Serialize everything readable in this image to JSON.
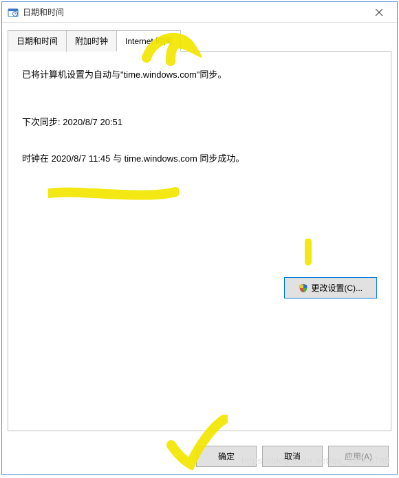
{
  "window": {
    "title": "日期和时间"
  },
  "tabs": [
    {
      "label": "日期和时间",
      "active": false
    },
    {
      "label": "附加时钟",
      "active": false
    },
    {
      "label": "Internet 时间",
      "active": true
    }
  ],
  "panel": {
    "status_line": "已将计算机设置为自动与\"time.windows.com\"同步。",
    "next_sync_label": "下次同步:",
    "next_sync_value": "2020/8/7 20:51",
    "last_sync_text": "时钟在 2020/8/7 11:45 与 time.windows.com 同步成功。",
    "change_settings_label": "更改设置(C)..."
  },
  "buttons": {
    "ok": "确定",
    "cancel": "取消",
    "apply": "应用(A)"
  },
  "icons": {
    "shield": "shield-icon",
    "close": "close-icon",
    "datetime": "datetime-icon"
  },
  "colors": {
    "border": "#5a8fd6",
    "highlight": "#f2e600"
  },
  "watermark": "https://blog.csdn.net/qq_43543789"
}
